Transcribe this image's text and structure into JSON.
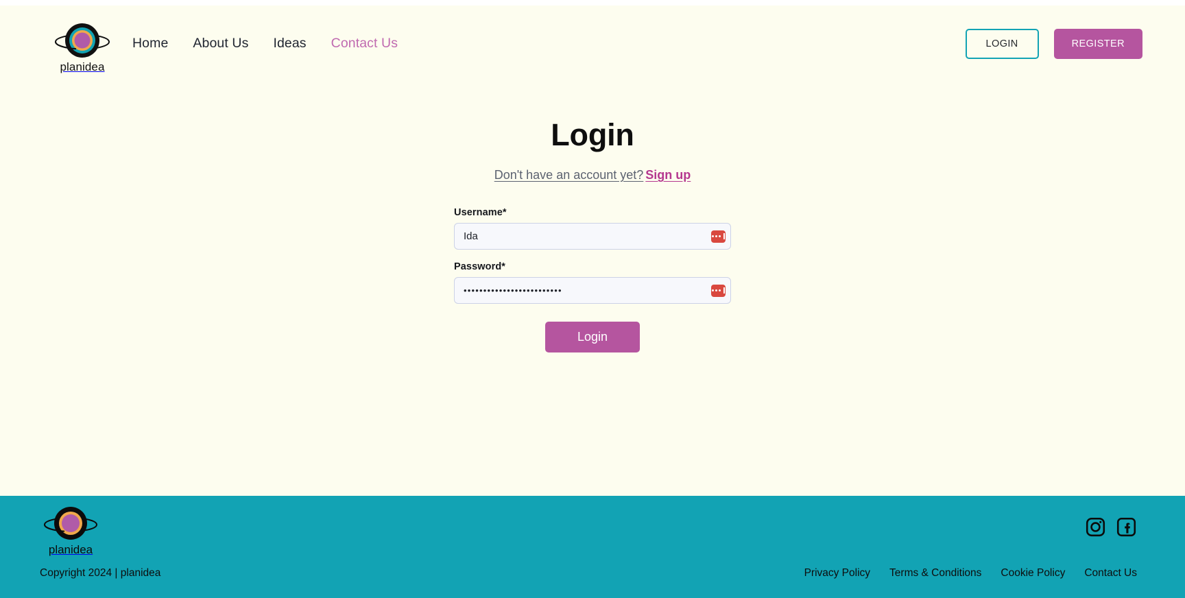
{
  "brand": {
    "name": "planidea",
    "logo_icon": "planet-logo-icon",
    "colors": {
      "ring_outer": "#111111",
      "ring_teal": "#12A3B4",
      "ring_orange": "#F0A84B",
      "core_purple": "#B05BA8",
      "page_background": "#FDFDEF",
      "footer_background": "#12A3B4",
      "accent_magenta": "#B5559F",
      "accent_teal": "#12A3B4"
    }
  },
  "header": {
    "nav": [
      {
        "label": "Home",
        "active": false
      },
      {
        "label": "About Us",
        "active": false
      },
      {
        "label": "Ideas",
        "active": false
      },
      {
        "label": "Contact Us",
        "active": true
      }
    ],
    "login_button": "LOGIN",
    "register_button": "REGISTER"
  },
  "main": {
    "title": "Login",
    "signup_prompt": "Don't have an account yet?",
    "signup_link": "Sign up",
    "form": {
      "username": {
        "label": "Username*",
        "value": "Ida",
        "placeholder": "",
        "autofill_icon": "password-manager-icon"
      },
      "password": {
        "label": "Password*",
        "value": "•••••••••••••••••••••••••",
        "placeholder": "",
        "autofill_icon": "password-manager-icon"
      },
      "submit_label": "Login"
    }
  },
  "footer": {
    "brand_name": "planidea",
    "copyright": "Copyright 2024 | planidea",
    "links": [
      {
        "label": "Privacy Policy"
      },
      {
        "label": "Terms & Conditions"
      },
      {
        "label": "Cookie Policy"
      },
      {
        "label": "Contact Us"
      }
    ],
    "social": [
      {
        "icon": "instagram-icon"
      },
      {
        "icon": "facebook-icon"
      }
    ]
  }
}
